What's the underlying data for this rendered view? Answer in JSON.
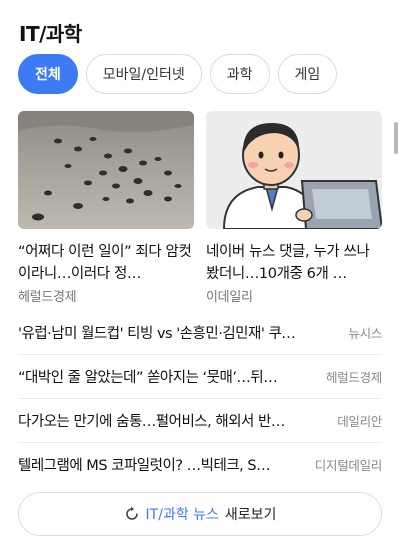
{
  "section": {
    "title": "IT/과학"
  },
  "tabs": [
    {
      "label": "전체",
      "active": true
    },
    {
      "label": "모바일/인터넷",
      "active": false
    },
    {
      "label": "과학",
      "active": false
    },
    {
      "label": "게임",
      "active": false
    }
  ],
  "cards": [
    {
      "title": "“어쩌다 이런 일이” 죄다 암컷이라니…이러다 정…",
      "source": "헤럴드경제",
      "image": "turtle-hatchlings-on-beach"
    },
    {
      "title": "네이버 뉴스 댓글, 누가 쓰나 봤더니…10개중 6개 …",
      "source": "이데일리",
      "image": "man-at-laptop-illustration"
    }
  ],
  "list": [
    {
      "title": "'유럽·남미 월드컵' 티빙 vs '손흥민·김민재' 쿠…",
      "source": "뉴시스"
    },
    {
      "title": "“대박인 줄 알았는데” 쏟아지는 ‘뭇매’…뒤…",
      "source": "헤럴드경제"
    },
    {
      "title": "다가오는 만기에 숨통…펄어비스, 해외서 반…",
      "source": "데일리안"
    },
    {
      "title": "텔레그램에 MS 코파일럿이? …빅테크, S…",
      "source": "디지털데일리"
    }
  ],
  "more": {
    "accent": "IT/과학 뉴스",
    "label": "새로보기",
    "icon": "refresh-icon"
  },
  "colors": {
    "accent": "#3d7bf5"
  }
}
